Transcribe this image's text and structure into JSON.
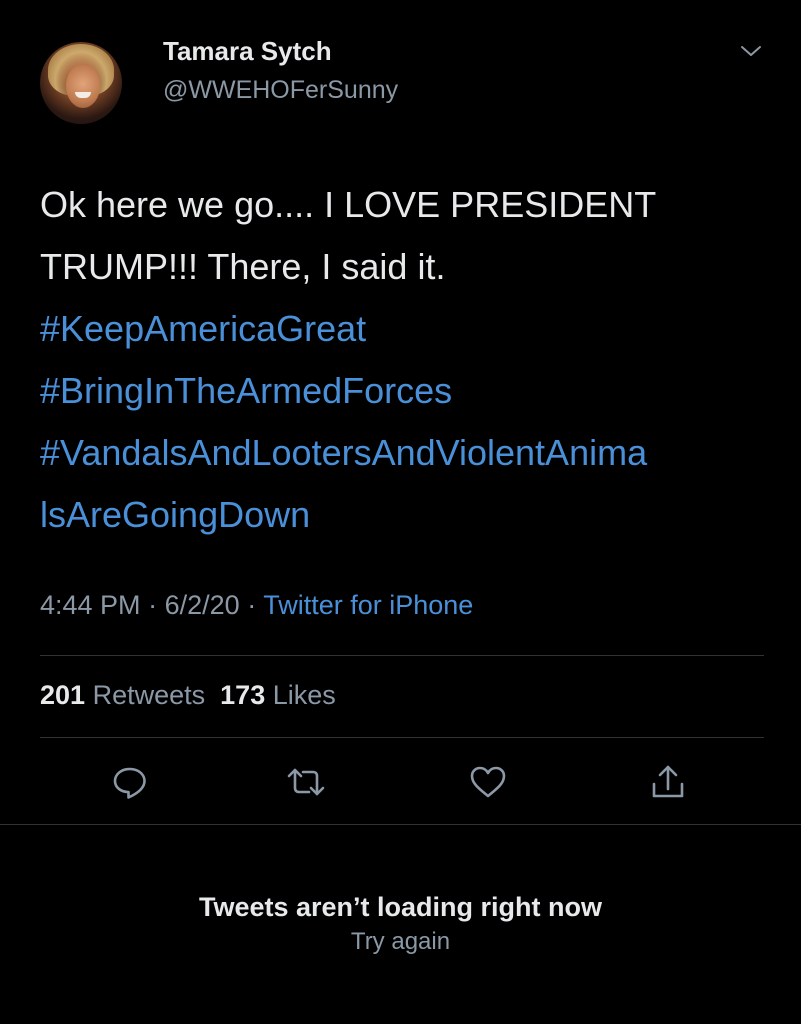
{
  "tweet": {
    "author": {
      "name": "Tamara Sytch",
      "handle": "@WWEHOFerSunny",
      "avatar_icon": "profile-photo"
    },
    "text_lines": [
      "Ok here we go....  I LOVE PRESIDENT",
      "TRUMP!!!  There, I said it."
    ],
    "hashtag_lines": [
      "#KeepAmericaGreat",
      "#BringInTheArmedForces",
      "#VandalsAndLootersAndViolentAnima",
      "lsAreGoingDown"
    ],
    "time": "4:44 PM",
    "date": "6/2/20",
    "source": "Twitter for iPhone",
    "separator": "·",
    "retweets_count": "201",
    "retweets_label": "Retweets",
    "likes_count": "173",
    "likes_label": "Likes",
    "actions": [
      {
        "name": "reply",
        "icon": "speech-bubble-icon"
      },
      {
        "name": "retweet",
        "icon": "retweet-arrows-icon"
      },
      {
        "name": "like",
        "icon": "heart-icon"
      },
      {
        "name": "share",
        "icon": "share-upload-icon"
      }
    ]
  },
  "feed_status": {
    "message": "Tweets aren’t loading right now",
    "retry_label": "Try again"
  },
  "colors": {
    "background": "#000000",
    "primary_text": "#e7e9ea",
    "secondary_text": "#8b98a5",
    "link": "#4a90d9",
    "divider": "#2f3336"
  }
}
